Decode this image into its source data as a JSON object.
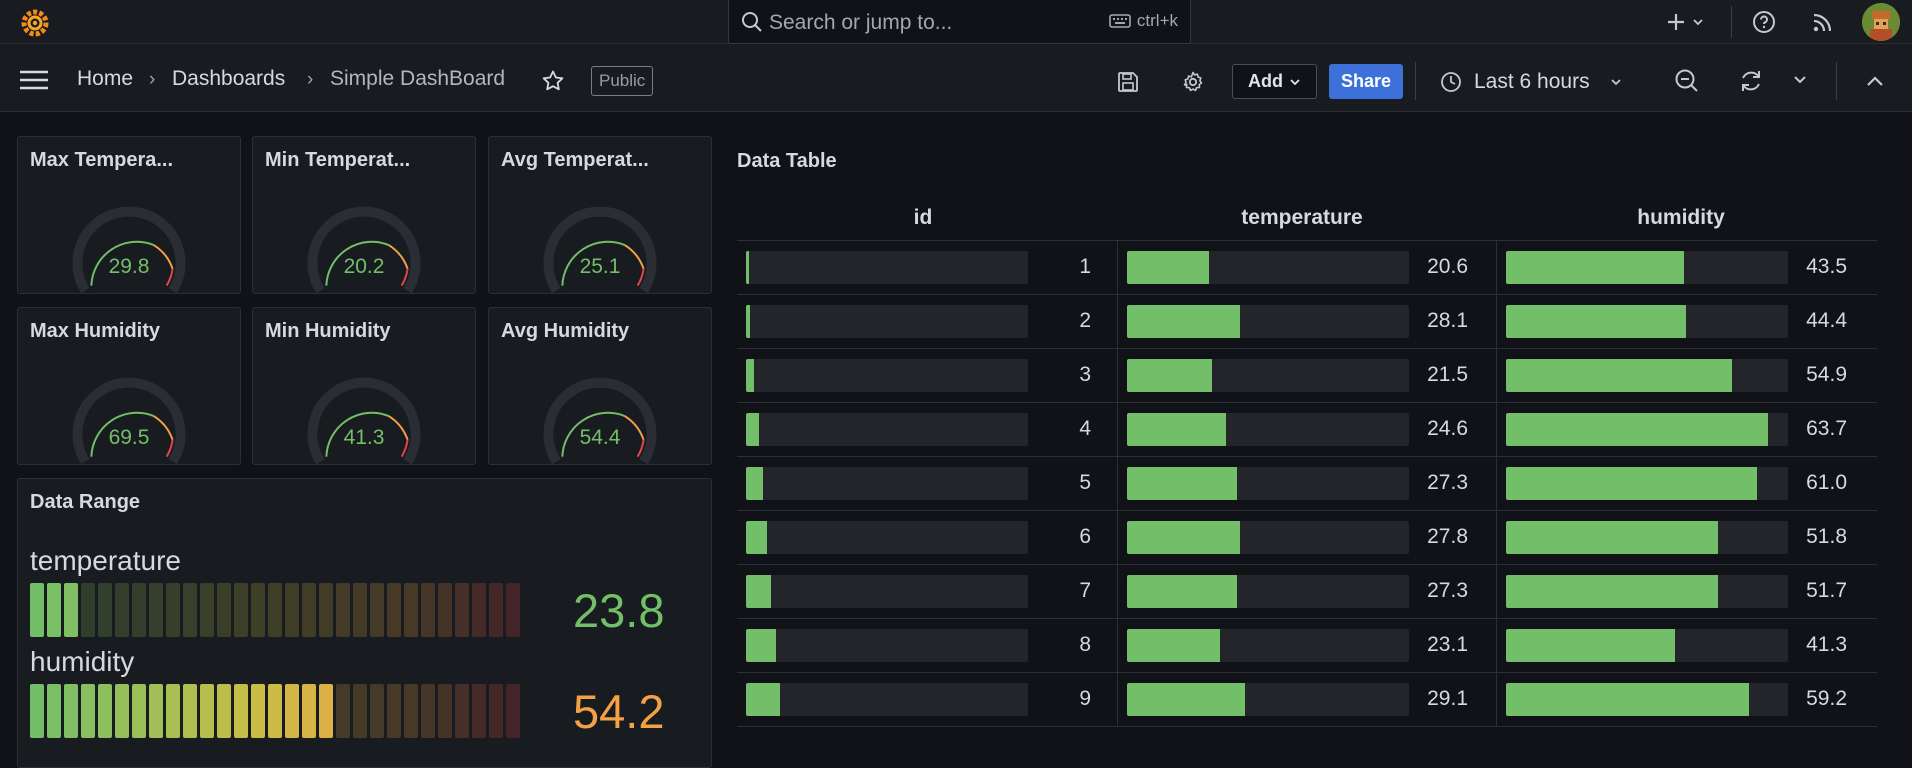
{
  "topbar": {
    "search_placeholder": "Search or jump to...",
    "search_shortcut": "ctrl+k"
  },
  "breadcrumb": {
    "home": "Home",
    "dashboards": "Dashboards",
    "current": "Simple DashBoard"
  },
  "dashboard": {
    "public_badge": "Public",
    "add_label": "Add",
    "share_label": "Share",
    "time_range": "Last 6 hours"
  },
  "gauges": [
    {
      "title": "Max Tempera...",
      "value": "29.8"
    },
    {
      "title": "Min Temperat...",
      "value": "20.2"
    },
    {
      "title": "Avg Temperat...",
      "value": "25.1"
    },
    {
      "title": "Max Humidity",
      "value": "69.5"
    },
    {
      "title": "Min Humidity",
      "value": "41.3"
    },
    {
      "title": "Avg Humidity",
      "value": "54.4"
    }
  ],
  "range_panel": {
    "title": "Data Range",
    "items": [
      {
        "label": "temperature",
        "value": "23.8",
        "lit_cells": 3,
        "color": "#73bf69"
      },
      {
        "label": "humidity",
        "value": "54.2",
        "lit_cells": 18,
        "color": "#f2a145"
      }
    ]
  },
  "table": {
    "title": "Data Table",
    "columns": [
      "id",
      "temperature",
      "humidity"
    ],
    "rows": [
      {
        "id": "1",
        "temperature": "20.6",
        "humidity": "43.5",
        "id_fill": 0.01,
        "t_fill": 0.29,
        "h_fill": 0.63
      },
      {
        "id": "2",
        "temperature": "28.1",
        "humidity": "44.4",
        "id_fill": 0.015,
        "t_fill": 0.4,
        "h_fill": 0.64
      },
      {
        "id": "3",
        "temperature": "21.5",
        "humidity": "54.9",
        "id_fill": 0.03,
        "t_fill": 0.3,
        "h_fill": 0.8
      },
      {
        "id": "4",
        "temperature": "24.6",
        "humidity": "63.7",
        "id_fill": 0.045,
        "t_fill": 0.35,
        "h_fill": 0.93
      },
      {
        "id": "5",
        "temperature": "27.3",
        "humidity": "61.0",
        "id_fill": 0.06,
        "t_fill": 0.39,
        "h_fill": 0.89
      },
      {
        "id": "6",
        "temperature": "27.8",
        "humidity": "51.8",
        "id_fill": 0.075,
        "t_fill": 0.4,
        "h_fill": 0.75
      },
      {
        "id": "7",
        "temperature": "27.3",
        "humidity": "51.7",
        "id_fill": 0.09,
        "t_fill": 0.39,
        "h_fill": 0.75
      },
      {
        "id": "8",
        "temperature": "23.1",
        "humidity": "41.3",
        "id_fill": 0.105,
        "t_fill": 0.33,
        "h_fill": 0.6
      },
      {
        "id": "9",
        "temperature": "29.1",
        "humidity": "59.2",
        "id_fill": 0.12,
        "t_fill": 0.42,
        "h_fill": 0.86
      }
    ]
  },
  "colors": {
    "green": "#73bf69",
    "orange": "#f2a145",
    "red": "#e0454b",
    "share_blue": "#3d71d9"
  }
}
